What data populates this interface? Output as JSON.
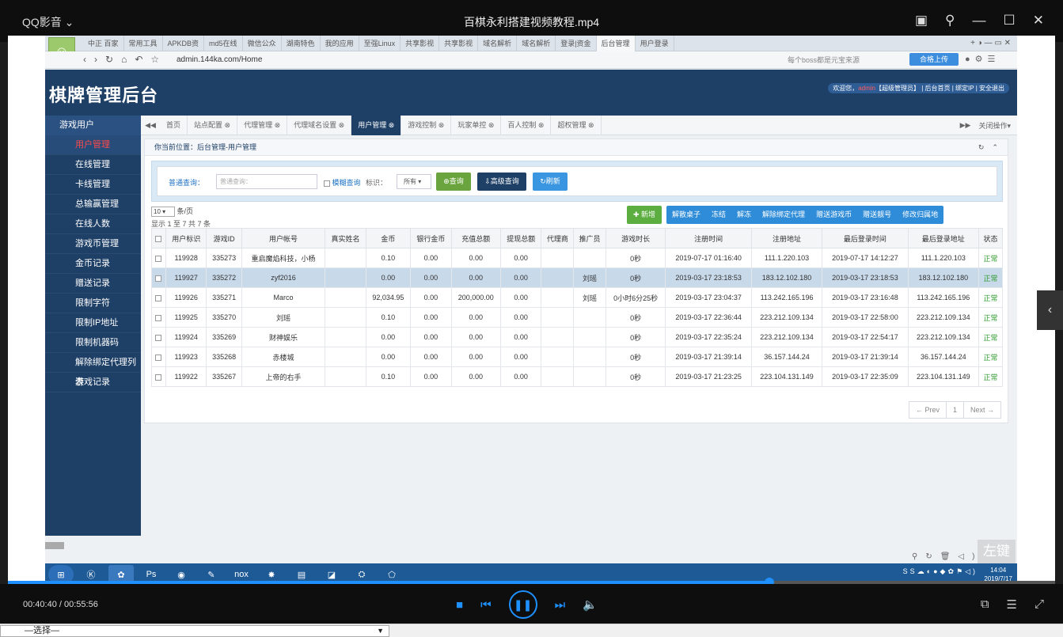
{
  "player": {
    "app_name": "QQ影音 ⌄",
    "title": "百棋永利搭建视频教程.mp4",
    "time": "00:40:40 / 00:55:56",
    "progress": 0.727,
    "watermark": "左键"
  },
  "browser": {
    "tabs": [
      "中正 百家",
      "常用工具",
      "APKDB资",
      "md5在线",
      "微信公众",
      "湖南特色",
      "我的应用",
      "至强Linux",
      "共享影视",
      "共享影视",
      "域名解析",
      "域名解析",
      "登录|资金",
      "后台管理",
      "用户登录"
    ],
    "active_tab_index": 13,
    "url": "admin.144ka.com/Home",
    "search_placeholder": "每个boss都是元宝来源",
    "upload_label": "合格上传"
  },
  "admin": {
    "logo": "棋牌管理后台",
    "welcome_prefix": "欢迎您，",
    "welcome_user": "admin",
    "welcome_suffix": "【超级管理员】 | 后台首页 | 绑定IP | 安全退出",
    "sidebar_head": "游戏用户",
    "sidebar_items": [
      "用户管理",
      "在线管理",
      "卡线管理",
      "总输赢管理",
      "在线人数",
      "游戏币管理",
      "金币记录",
      "赠送记录",
      "限制字符",
      "限制IP地址",
      "限制机器码",
      "解除绑定代理列表",
      "游戏记录"
    ],
    "page_tabs": [
      "首页",
      "站点配置",
      "代理管理",
      "代理域名设置",
      "用户管理",
      "游戏控制",
      "玩家单控",
      "百人控制",
      "超权管理"
    ],
    "active_page_tab": 4,
    "close_ops": "关闭操作▾",
    "breadcrumb": "你当前位置：后台管理-用户管理",
    "search": {
      "label": "普通查询：",
      "placeholder": "普通查询：",
      "fuzzy": "模糊查询",
      "ident_label": "标识：",
      "ident_value": "所有",
      "btn_query": "查询",
      "btn_advanced": "高级查询",
      "btn_refresh": "刷新"
    },
    "page_size": "10",
    "page_size_suffix": "条/页",
    "count_text": "显示 1 至 7 共 7 条",
    "btn_new": "新增",
    "actions": [
      "解散桌子",
      "冻结",
      "解冻",
      "解除绑定代理",
      "赠送游戏币",
      "赠送靓号",
      "修改归属地"
    ],
    "columns": [
      "用户标识",
      "游戏ID",
      "用户帐号",
      "真实姓名",
      "金币",
      "银行金币",
      "充值总额",
      "提现总额",
      "代理商",
      "推广员",
      "游戏时长",
      "注册时间",
      "注册地址",
      "最后登录时间",
      "最后登录地址",
      "状态"
    ],
    "rows": [
      [
        "119928",
        "335273",
        "重启魔焰科技，小杨",
        "",
        "0.10",
        "0.00",
        "0.00",
        "0.00",
        "",
        "",
        "0秒",
        "2019-07-17 01:16:40",
        "111.1.220.103",
        "2019-07-17 14:12:27",
        "111.1.220.103",
        "正常"
      ],
      [
        "119927",
        "335272",
        "zyf2016",
        "",
        "0.00",
        "0.00",
        "0.00",
        "0.00",
        "",
        "刘瑶",
        "0秒",
        "2019-03-17 23:18:53",
        "183.12.102.180",
        "2019-03-17 23:18:53",
        "183.12.102.180",
        "正常"
      ],
      [
        "119926",
        "335271",
        "Marco",
        "",
        "92,034.95",
        "0.00",
        "200,000.00",
        "0.00",
        "",
        "刘瑶",
        "0小时6分25秒",
        "2019-03-17 23:04:37",
        "113.242.165.196",
        "2019-03-17 23:16:48",
        "113.242.165.196",
        "正常"
      ],
      [
        "119925",
        "335270",
        "刘瑶",
        "",
        "0.10",
        "0.00",
        "0.00",
        "0.00",
        "",
        "",
        "0秒",
        "2019-03-17 22:36:44",
        "223.212.109.134",
        "2019-03-17 22:58:00",
        "223.212.109.134",
        "正常"
      ],
      [
        "119924",
        "335269",
        "财神娱乐",
        "",
        "0.00",
        "0.00",
        "0.00",
        "0.00",
        "",
        "",
        "0秒",
        "2019-03-17 22:35:24",
        "223.212.109.134",
        "2019-03-17 22:54:17",
        "223.212.109.134",
        "正常"
      ],
      [
        "119923",
        "335268",
        "赤楼城",
        "",
        "0.00",
        "0.00",
        "0.00",
        "0.00",
        "",
        "",
        "0秒",
        "2019-03-17 21:39:14",
        "36.157.144.24",
        "2019-03-17 21:39:14",
        "36.157.144.24",
        "正常"
      ],
      [
        "119922",
        "335267",
        "上帝的右手",
        "",
        "0.10",
        "0.00",
        "0.00",
        "0.00",
        "",
        "",
        "0秒",
        "2019-03-17 21:23:25",
        "223.104.131.149",
        "2019-03-17 22:35:09",
        "223.104.131.149",
        "正常"
      ]
    ],
    "selected_row": 1,
    "pager": [
      "← Prev",
      "1",
      "Next →"
    ]
  },
  "taskbar": {
    "clock_time": "14:04",
    "clock_date": "2019/7/17"
  },
  "bottom_select": "—选择—"
}
